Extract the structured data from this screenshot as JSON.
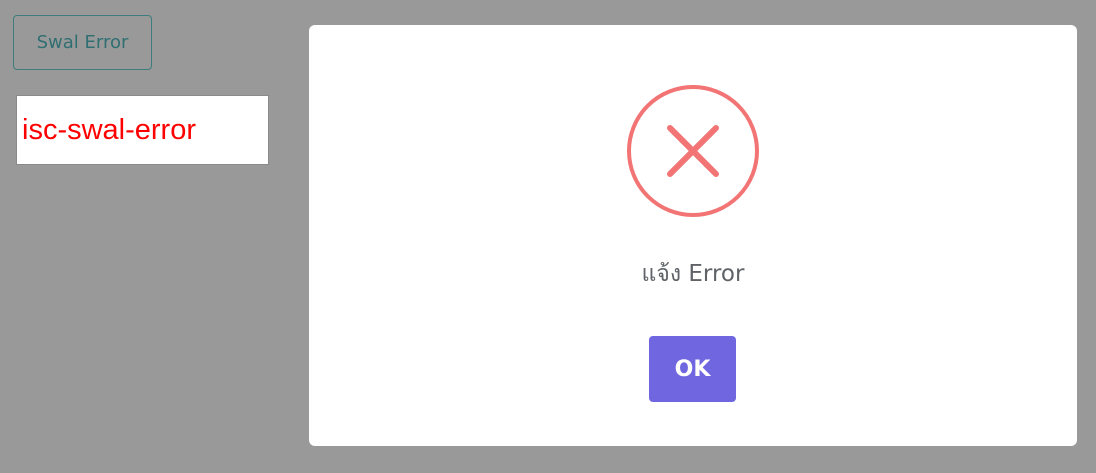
{
  "trigger_button": {
    "label": "Swal Error"
  },
  "class_label": {
    "text": "isc-swal-error",
    "color": "#ff0000"
  },
  "modal": {
    "icon": "error-x-icon",
    "icon_color": "#f27474",
    "title": "แจ้ง Error",
    "confirm_button": {
      "label": "OK",
      "color": "#7066e0"
    }
  },
  "colors": {
    "overlay": "#999999",
    "trigger_border": "#3e7d7d",
    "trigger_text": "#2f6f72"
  }
}
